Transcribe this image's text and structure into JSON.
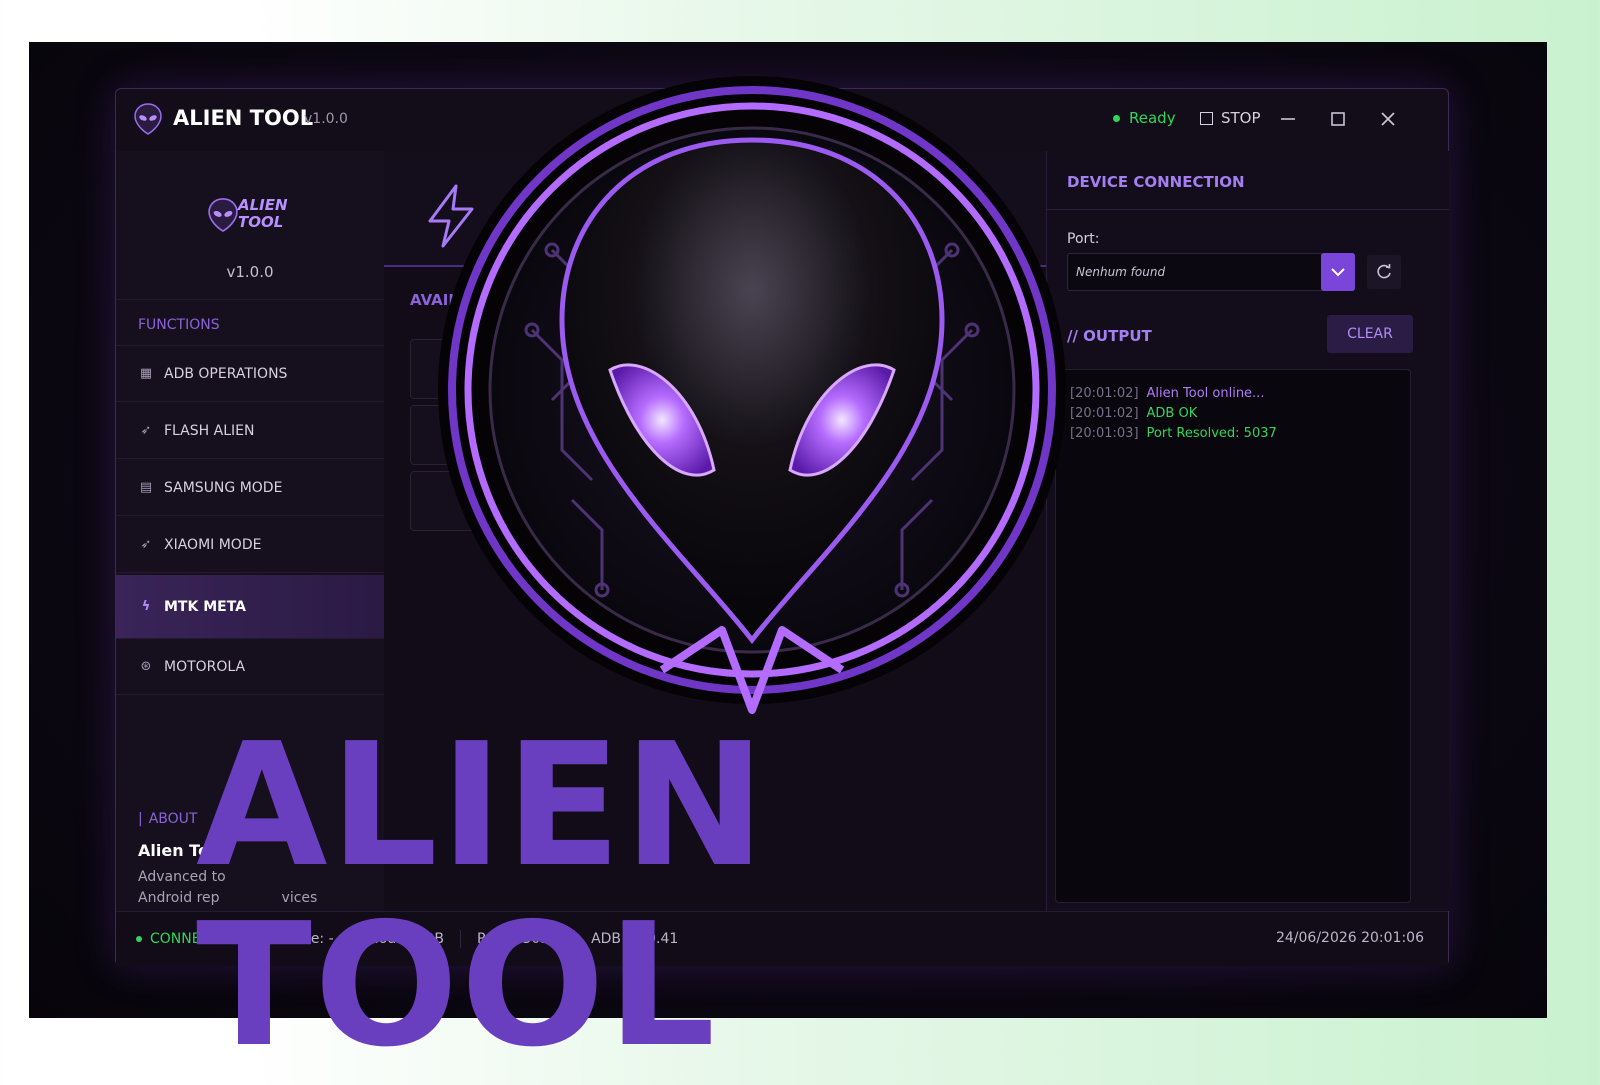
{
  "app": {
    "title": "ALIEN TOOL",
    "version": "v1.0.0",
    "status": "Ready",
    "stop_label": "STOP"
  },
  "sidebar": {
    "logo_text": "ALIEN TOOL",
    "version": "v1.0.0",
    "section_label": "FUNCTIONS",
    "items": [
      {
        "label": "ADB OPERATIONS",
        "icon": "adb-icon"
      },
      {
        "label": "FLASH ALIEN",
        "icon": "rocket-icon"
      },
      {
        "label": "SAMSUNG MODE",
        "icon": "samsung-icon"
      },
      {
        "label": "XIAOMI MODE",
        "icon": "xiaomi-icon"
      },
      {
        "label": "MTK META",
        "icon": "bolt-icon",
        "active": true
      },
      {
        "label": "MOTOROLA",
        "icon": "motorola-icon"
      }
    ],
    "about": {
      "label": "ABOUT",
      "name": "Alien Tool",
      "desc_line1": "Advanced to",
      "desc_line2": "Android rep",
      "desc_line2_tail": "vices"
    }
  },
  "center": {
    "available_label": "AVAIL"
  },
  "device": {
    "title": "DEVICE CONNECTION",
    "port_label": "Port:",
    "port_value": "Nenhum found",
    "output_title": "// OUTPUT",
    "clear_label": "CLEAR",
    "log": [
      {
        "time": "[20:01:02]",
        "text": "Alien Tool online...",
        "color": "#b07cf7"
      },
      {
        "time": "[20:01:02]",
        "text": "ADB OK",
        "color": "#31d65a"
      },
      {
        "time": "[20:01:03]",
        "text": "Port Resolved: 5037",
        "color": "#31d65a"
      }
    ]
  },
  "statusbar": {
    "connected": "CONNECTED",
    "device": "Device: -",
    "mode": "Mode: ADB",
    "port": "Porta: 5037",
    "adb": "ADB v1.0.41",
    "datetime": "24/06/2026  20:01:06"
  },
  "overlay": {
    "headline": "ALIEN TOOL"
  },
  "colors": {
    "accent": "#7b45d9",
    "ok": "#31d65a",
    "headline": "#6a3fbf"
  }
}
